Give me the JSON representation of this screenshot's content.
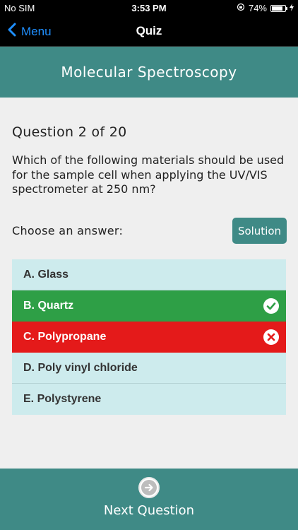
{
  "status_bar": {
    "carrier": "No SIM",
    "time": "3:53 PM",
    "battery": "74%"
  },
  "nav": {
    "back_label": "Menu",
    "title": "Quiz"
  },
  "banner": {
    "title": "Molecular Spectroscopy"
  },
  "question": {
    "number_label": "Question 2 of 20",
    "text": "Which of the following materials should be used for the sample cell when applying the UV/VIS spectrometer at 250 nm?"
  },
  "choose_label": "Choose an answer:",
  "solution_label": "Solution",
  "answers": [
    {
      "label": "A. Glass",
      "state": "neutral"
    },
    {
      "label": "B. Quartz",
      "state": "correct"
    },
    {
      "label": "C. Polypropane",
      "state": "wrong"
    },
    {
      "label": "D. Poly vinyl chloride",
      "state": "neutral"
    },
    {
      "label": "E. Polystyrene",
      "state": "neutral"
    }
  ],
  "footer": {
    "next_label": "Next Question"
  },
  "colors": {
    "teal": "#3f8a86",
    "correct": "#2e9f46",
    "wrong": "#e41a1a",
    "answer_bg": "#cdebed",
    "link_blue": "#1f8fff"
  }
}
